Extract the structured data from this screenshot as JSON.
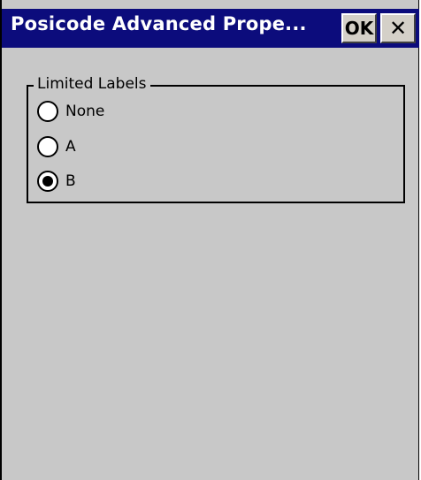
{
  "window": {
    "title": "Posicode Advanced Prope...",
    "ok_label": "OK",
    "close_label": "✕"
  },
  "group": {
    "label": "Limited Labels",
    "options": [
      {
        "label": "None",
        "selected": false
      },
      {
        "label": "A",
        "selected": false
      },
      {
        "label": "B",
        "selected": true
      }
    ]
  }
}
